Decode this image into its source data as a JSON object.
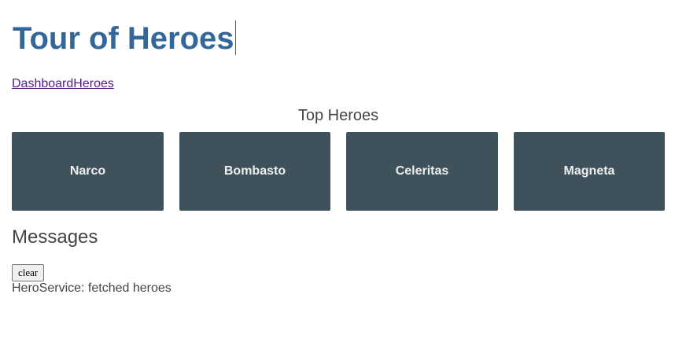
{
  "app": {
    "title": "Tour of Heroes"
  },
  "nav": {
    "dashboard_label": "Dashboard",
    "heroes_label": "Heroes"
  },
  "dashboard": {
    "heading": "Top Heroes",
    "heroes": [
      {
        "name": "Narco"
      },
      {
        "name": "Bombasto"
      },
      {
        "name": "Celeritas"
      },
      {
        "name": "Magneta"
      }
    ]
  },
  "messages": {
    "heading": "Messages",
    "clear_label": "clear",
    "items": [
      "HeroService: fetched heroes"
    ]
  },
  "colors": {
    "title": "#336699",
    "card_background": "#3f525c",
    "card_text": "#eeeeee",
    "link_visited": "#551a8b"
  }
}
